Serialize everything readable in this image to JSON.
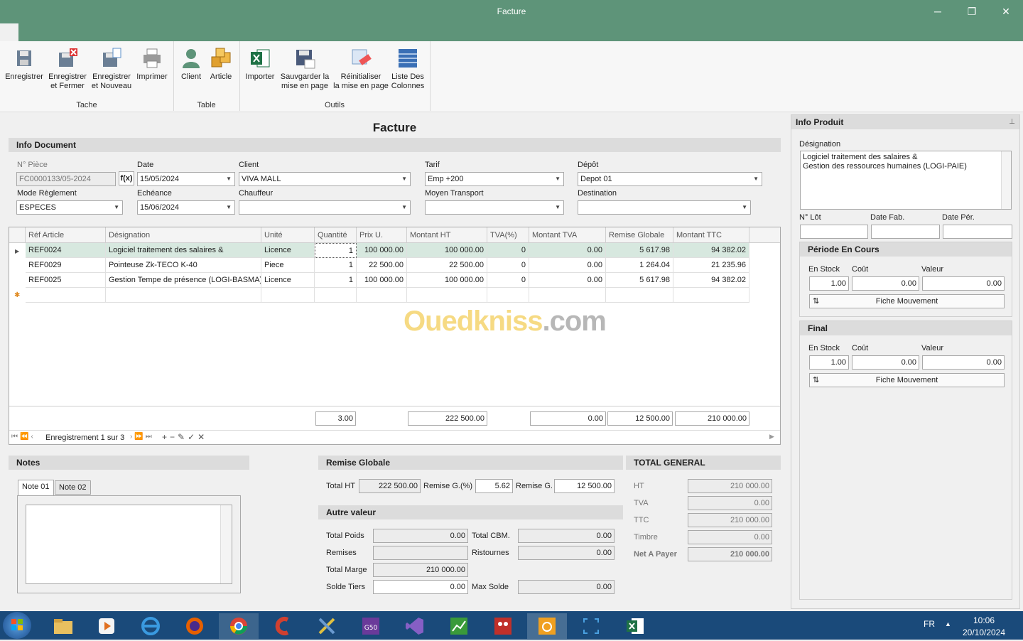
{
  "window": {
    "title": "Facture",
    "minimize": "─",
    "restore": "❐",
    "close": "✕"
  },
  "ribbon": {
    "buttons": [
      {
        "label": "Enregistrer"
      },
      {
        "label": "Enregistrer\net Fermer"
      },
      {
        "label": "Enregistrer\net Nouveau"
      },
      {
        "label": "Imprimer"
      },
      {
        "label": "Client"
      },
      {
        "label": "Article"
      },
      {
        "label": "Importer"
      },
      {
        "label": "Sauvgarder la\nmise en page"
      },
      {
        "label": "Réinitialiser\nla mise en page"
      },
      {
        "label": "Liste Des\nColonnes"
      }
    ],
    "groups": [
      "Tache",
      "Table",
      "Outils"
    ]
  },
  "form": {
    "title": "Facture",
    "info_document": "Info Document",
    "num_piece_label": "N° Pièce",
    "num_piece": "FC0000133/05-2024",
    "fx": "f(x)",
    "date_label": "Date",
    "date": "15/05/2024",
    "client_label": "Client",
    "client": "VIVA MALL",
    "tarif_label": "Tarif",
    "tarif": "Emp +200",
    "depot_label": "Dépôt",
    "depot": "Depot 01",
    "mode_label": "Mode Règlement",
    "mode": "ESPECES",
    "echeance_label": "Echéance",
    "echeance": "15/06/2024",
    "chauffeur_label": "Chauffeur",
    "chauffeur": "",
    "transport_label": "Moyen Transport",
    "transport": "",
    "destination_label": "Destination",
    "destination": ""
  },
  "grid": {
    "columns": [
      "Réf Article",
      "Désignation",
      "Unité",
      "Quantité",
      "Prix U.",
      "Montant HT",
      "TVA(%)",
      "Montant TVA",
      "Remise Globale",
      "Montant TTC"
    ],
    "rows": [
      [
        "REF0024",
        "Logiciel traitement des salaires &",
        "Licence",
        "1",
        "100 000.00",
        "100 000.00",
        "0",
        "0.00",
        "5 617.98",
        "94 382.02"
      ],
      [
        "REF0029",
        "Pointeuse Zk-TECO K-40",
        "Piece",
        "1",
        "22 500.00",
        "22 500.00",
        "0",
        "0.00",
        "1 264.04",
        "21 235.96"
      ],
      [
        "REF0025",
        "Gestion Tempe de présence (LOGI-BASMA)",
        "Licence",
        "1",
        "100 000.00",
        "100 000.00",
        "0",
        "0.00",
        "5 617.98",
        "94 382.02"
      ]
    ],
    "totals": {
      "quantite": "3.00",
      "montant_ht": "222 500.00",
      "montant_tva": "0.00",
      "remise": "12 500.00",
      "ttc": "210 000.00"
    },
    "nav_text": "Enregistrement 1 sur 3"
  },
  "watermark": {
    "part1": "Ouedkniss",
    "part2": ".com"
  },
  "notes": {
    "title": "Notes",
    "tab1": "Note 01",
    "tab2": "Note 02"
  },
  "remise": {
    "title": "Remise Globale",
    "total_ht_label": "Total HT",
    "total_ht": "222 500.00",
    "remise_pct_label": "Remise G.(%)",
    "remise_pct": "5.62",
    "remise_g_label": "Remise G.",
    "remise_g": "12 500.00"
  },
  "autre": {
    "title": "Autre valeur",
    "poids_label": "Total Poids",
    "poids": "0.00",
    "cbm_label": "Total CBM.",
    "cbm": "0.00",
    "remises_label": "Remises",
    "remises": "",
    "ristournes_label": "Ristournes",
    "ristournes": "0.00",
    "marge_label": "Total Marge",
    "marge": "210 000.00",
    "solde_label": "Solde Tiers",
    "solde": "0.00",
    "max_label": "Max Solde",
    "max": "0.00"
  },
  "total_general": {
    "title": "TOTAL GENERAL",
    "ht_label": "HT",
    "ht": "210 000.00",
    "tva_label": "TVA",
    "tva": "0.00",
    "ttc_label": "TTC",
    "ttc": "210 000.00",
    "timbre_label": "Timbre",
    "timbre": "0.00",
    "net_label": "Net A Payer",
    "net": "210 000.00"
  },
  "info_produit": {
    "title": "Info Produit",
    "designation_label": "Désignation",
    "designation": "Logiciel traitement des salaires &\nGestion des ressources humaines (LOGI-PAIE)",
    "lot_label": "N° Lôt",
    "fab_label": "Date Fab.",
    "per_label": "Date Pér.",
    "periode_title": "Période En Cours",
    "final_title": "Final",
    "stock_label": "En Stock",
    "cout_label": "Coût",
    "valeur_label": "Valeur",
    "periode": {
      "stock": "1.00",
      "cout": "0.00",
      "valeur": "0.00"
    },
    "final": {
      "stock": "1.00",
      "cout": "0.00",
      "valeur": "0.00"
    },
    "fiche_label": "Fiche Mouvement"
  },
  "taskbar": {
    "lang": "FR",
    "time": "10:06",
    "date": "20/10/2024"
  },
  "colors": {
    "titlebar": "#5e9479",
    "taskbar": "#1a4a7a",
    "selected_row": "#d7e8df"
  }
}
